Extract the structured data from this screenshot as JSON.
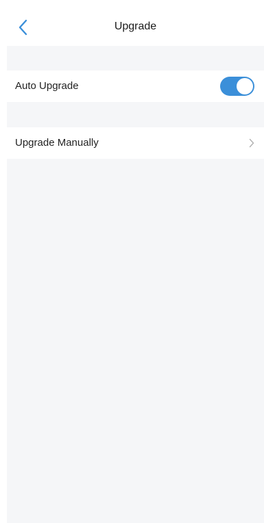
{
  "header": {
    "title": "Upgrade",
    "back_icon": "chevron-left-icon"
  },
  "settings": {
    "auto_upgrade": {
      "label": "Auto Upgrade",
      "enabled": true
    },
    "manual_upgrade": {
      "label": "Upgrade Manually",
      "icon": "chevron-right-icon"
    }
  },
  "colors": {
    "accent": "#3b8fd9",
    "background": "#f5f6f8",
    "surface": "#ffffff",
    "chevron": "#b0b0b0"
  }
}
